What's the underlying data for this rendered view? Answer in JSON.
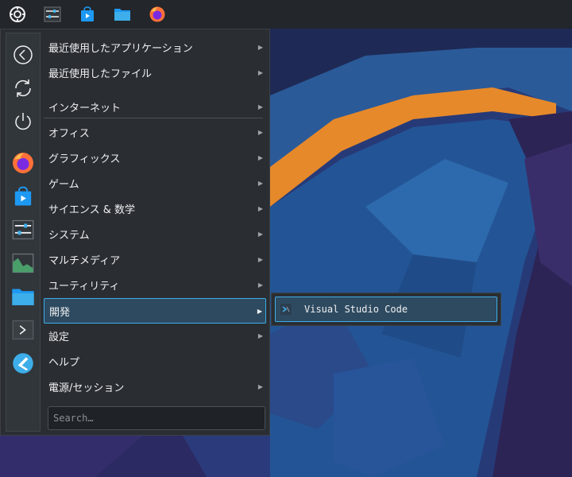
{
  "panel": {
    "items": [
      {
        "name": "application-launcher-icon"
      },
      {
        "name": "system-settings-icon"
      },
      {
        "name": "discover-store-icon"
      },
      {
        "name": "file-manager-icon"
      },
      {
        "name": "firefox-icon"
      }
    ]
  },
  "sidebar": {
    "items": [
      "back-icon",
      "refresh-icon",
      "power-icon",
      "firefox-icon",
      "discover-store-icon",
      "system-settings-icon",
      "system-monitor-icon",
      "file-manager-icon",
      "terminal-icon",
      "kde-connect-icon"
    ]
  },
  "menu": {
    "categories": [
      {
        "label": "最近使用したアプリケーション",
        "has_sub": true
      },
      {
        "label": "最近使用したファイル",
        "has_sub": true
      },
      {
        "label": "インターネット",
        "has_sub": true
      },
      {
        "label": "オフィス",
        "has_sub": true
      },
      {
        "label": "グラフィックス",
        "has_sub": true
      },
      {
        "label": "ゲーム",
        "has_sub": true
      },
      {
        "label": "サイエンス & 数学",
        "has_sub": true
      },
      {
        "label": "システム",
        "has_sub": true
      },
      {
        "label": "マルチメディア",
        "has_sub": true
      },
      {
        "label": "ユーティリティ",
        "has_sub": true
      },
      {
        "label": "開発",
        "has_sub": true,
        "active": true
      },
      {
        "label": "設定",
        "has_sub": true
      },
      {
        "label": "ヘルプ",
        "has_sub": false
      },
      {
        "label": "電源/セッション",
        "has_sub": true
      }
    ],
    "search_placeholder": "Search…"
  },
  "submenu": {
    "items": [
      {
        "label": "Visual Studio Code"
      }
    ]
  },
  "colors": {
    "accent": "#3daee9",
    "panel": "#23262b",
    "menu_bg": "#2a2e33",
    "firefox": "#ff7139"
  }
}
